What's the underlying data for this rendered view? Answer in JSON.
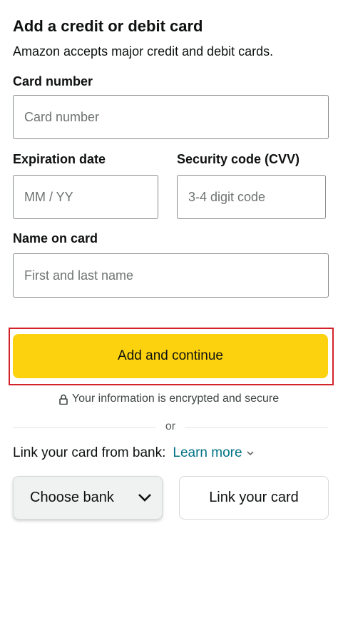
{
  "header": {
    "title": "Add a credit or debit card",
    "subtitle": "Amazon accepts major credit and debit cards."
  },
  "form": {
    "card_number": {
      "label": "Card number",
      "placeholder": "Card number",
      "value": ""
    },
    "expiration": {
      "label": "Expiration date",
      "placeholder": "MM / YY",
      "value": ""
    },
    "cvv": {
      "label": "Security code (CVV)",
      "placeholder": "3-4 digit code",
      "value": ""
    },
    "name": {
      "label": "Name on card",
      "placeholder": "First and last name",
      "value": ""
    }
  },
  "primary_button": {
    "label": "Add and continue",
    "color": "#fcd20f",
    "focus_ring_color": "#d2232a"
  },
  "security_note": {
    "text": "Your information is encrypted and secure",
    "icon": "lock-icon"
  },
  "divider": {
    "text": "or"
  },
  "bank_link": {
    "prompt": "Link your card from bank:",
    "learn_more": "Learn more",
    "learn_more_icon": "chevron-down-icon",
    "link_color": "#007185",
    "choose_bank_label": "Choose bank",
    "choose_bank_icon": "chevron-down-icon",
    "link_card_label": "Link your card"
  }
}
